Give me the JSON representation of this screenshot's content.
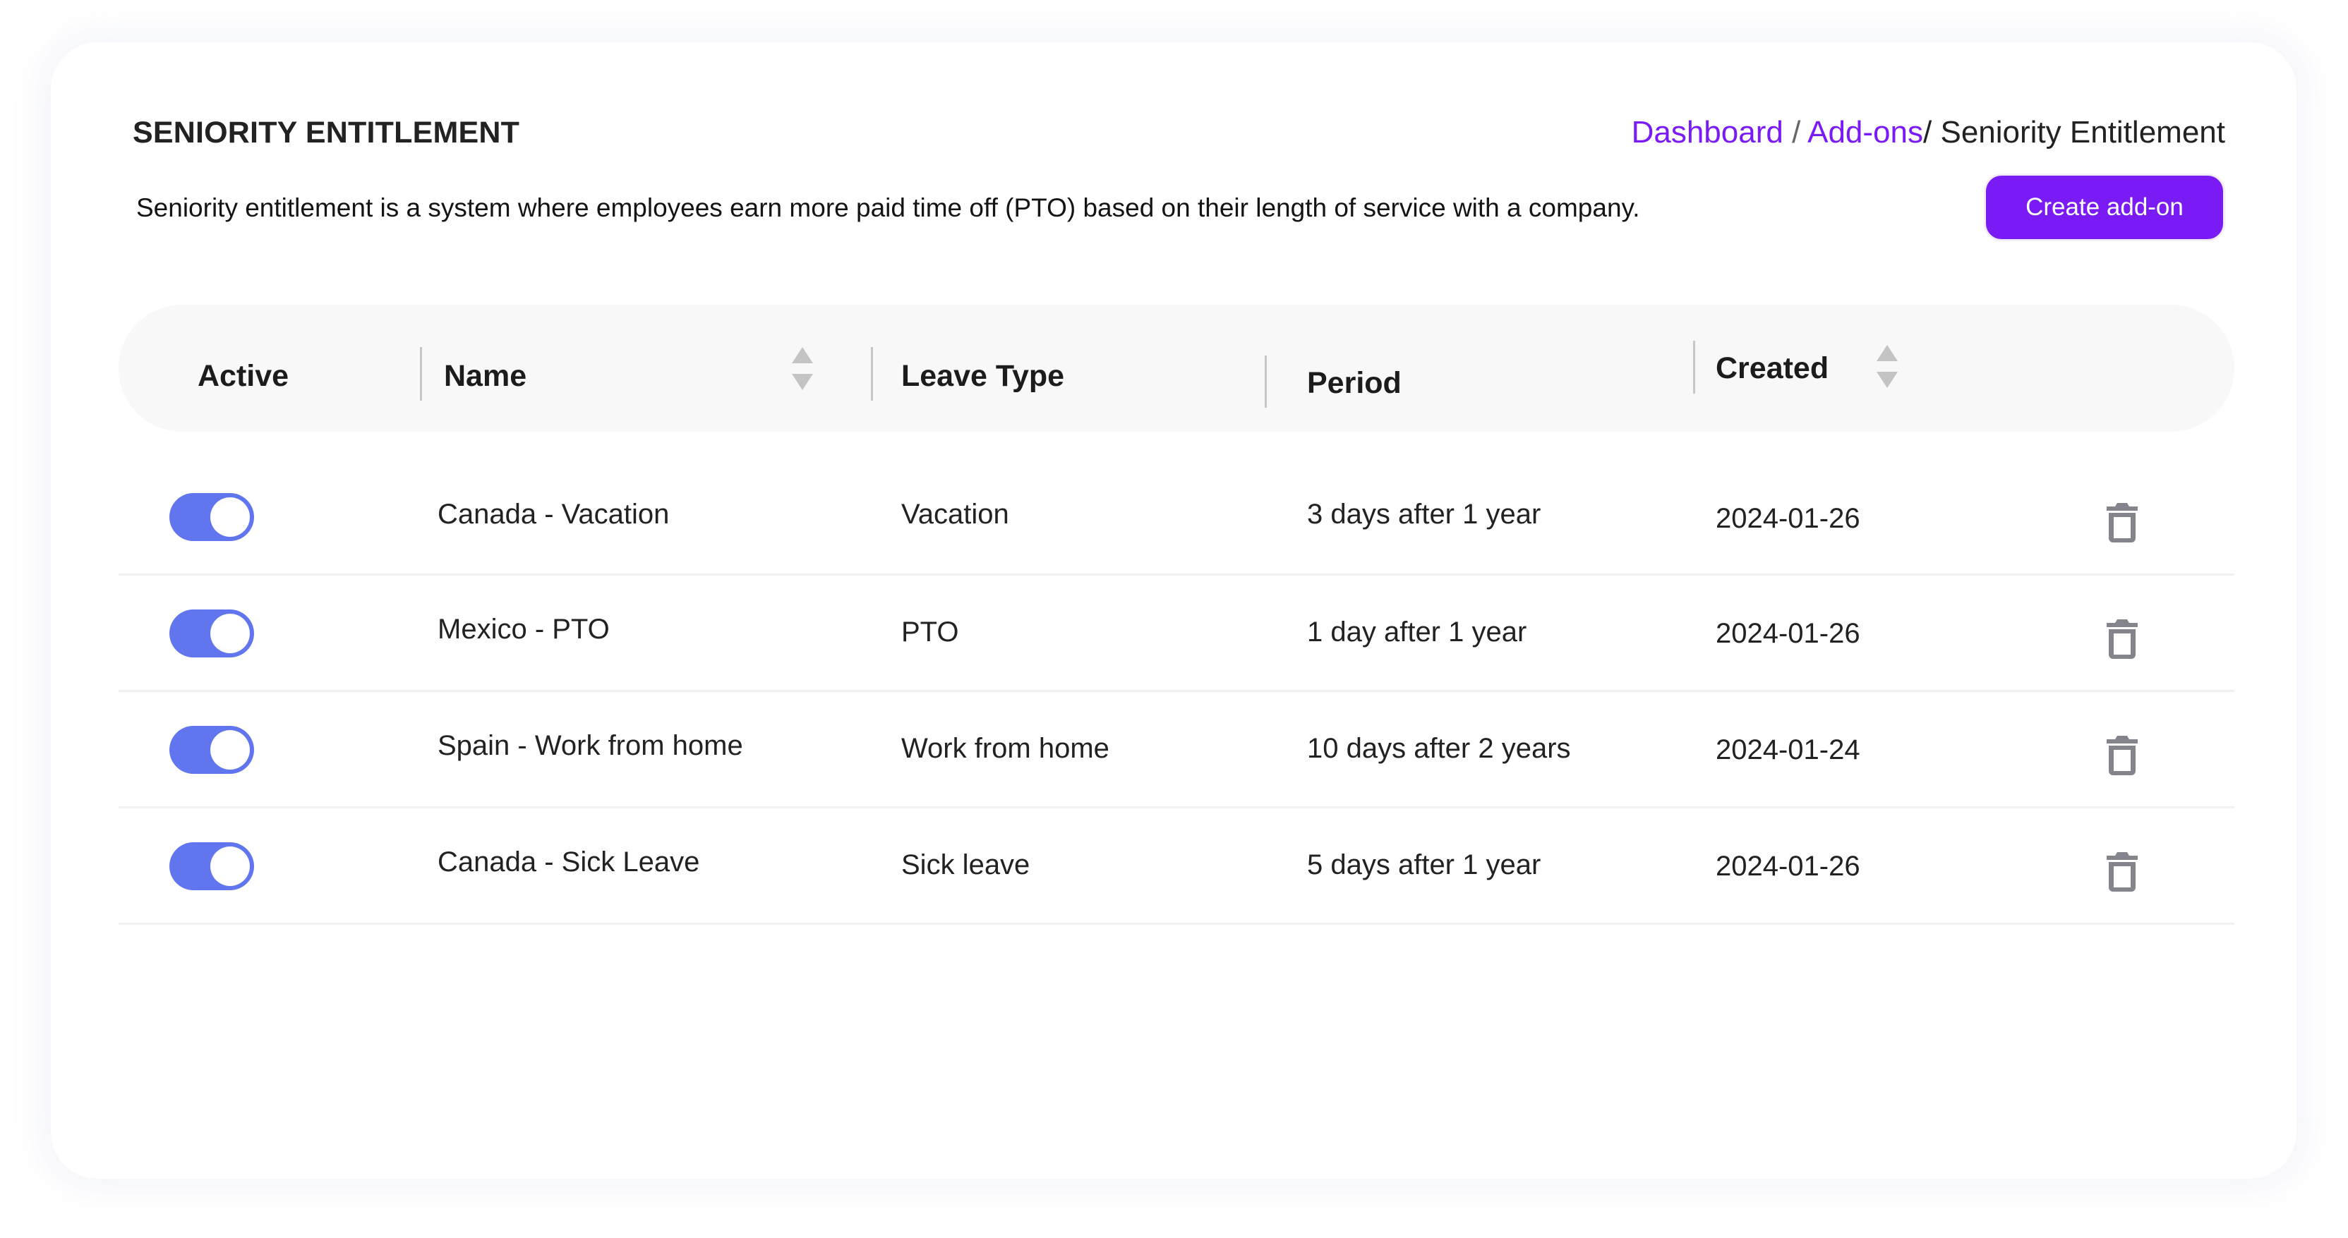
{
  "page": {
    "title": "SENIORITY ENTITLEMENT",
    "description": "Seniority entitlement is a system where employees earn more paid time off (PTO) based on their length of service with a company."
  },
  "breadcrumb": {
    "items": [
      {
        "label": "Dashboard",
        "link": true
      },
      {
        "label": "Add-ons",
        "link": true
      },
      {
        "label": "Seniority Entitlement",
        "link": false
      }
    ],
    "separator": "/"
  },
  "actions": {
    "create_label": "Create add-on"
  },
  "colors": {
    "accent": "#7a1bf6",
    "toggle_on": "#6176ee",
    "icon_grey": "#84848c",
    "header_bg": "#f8f8f8"
  },
  "table": {
    "columns": [
      {
        "label": "Active",
        "sortable": false
      },
      {
        "label": "Name",
        "sortable": true
      },
      {
        "label": "Leave Type",
        "sortable": false
      },
      {
        "label": "Period",
        "sortable": false
      },
      {
        "label": "Created",
        "sortable": true
      }
    ],
    "rows": [
      {
        "active": true,
        "name": "Canada - Vacation",
        "leave_type": "Vacation",
        "period": "3 days after 1 year",
        "created": "2024-01-26",
        "action_icon": "trash-icon"
      },
      {
        "active": true,
        "name": "Mexico - PTO",
        "leave_type": "PTO",
        "period": "1 day after 1 year",
        "created": "2024-01-26",
        "action_icon": "trash-icon"
      },
      {
        "active": true,
        "name": "Spain - Work from home",
        "leave_type": "Work from home",
        "period": "10 days after 2 years",
        "created": "2024-01-24",
        "action_icon": "trash-icon"
      },
      {
        "active": true,
        "name": "Canada - Sick Leave",
        "leave_type": "Sick leave",
        "period": "5 days after 1 year",
        "created": "2024-01-26",
        "action_icon": "trash-icon"
      }
    ]
  }
}
